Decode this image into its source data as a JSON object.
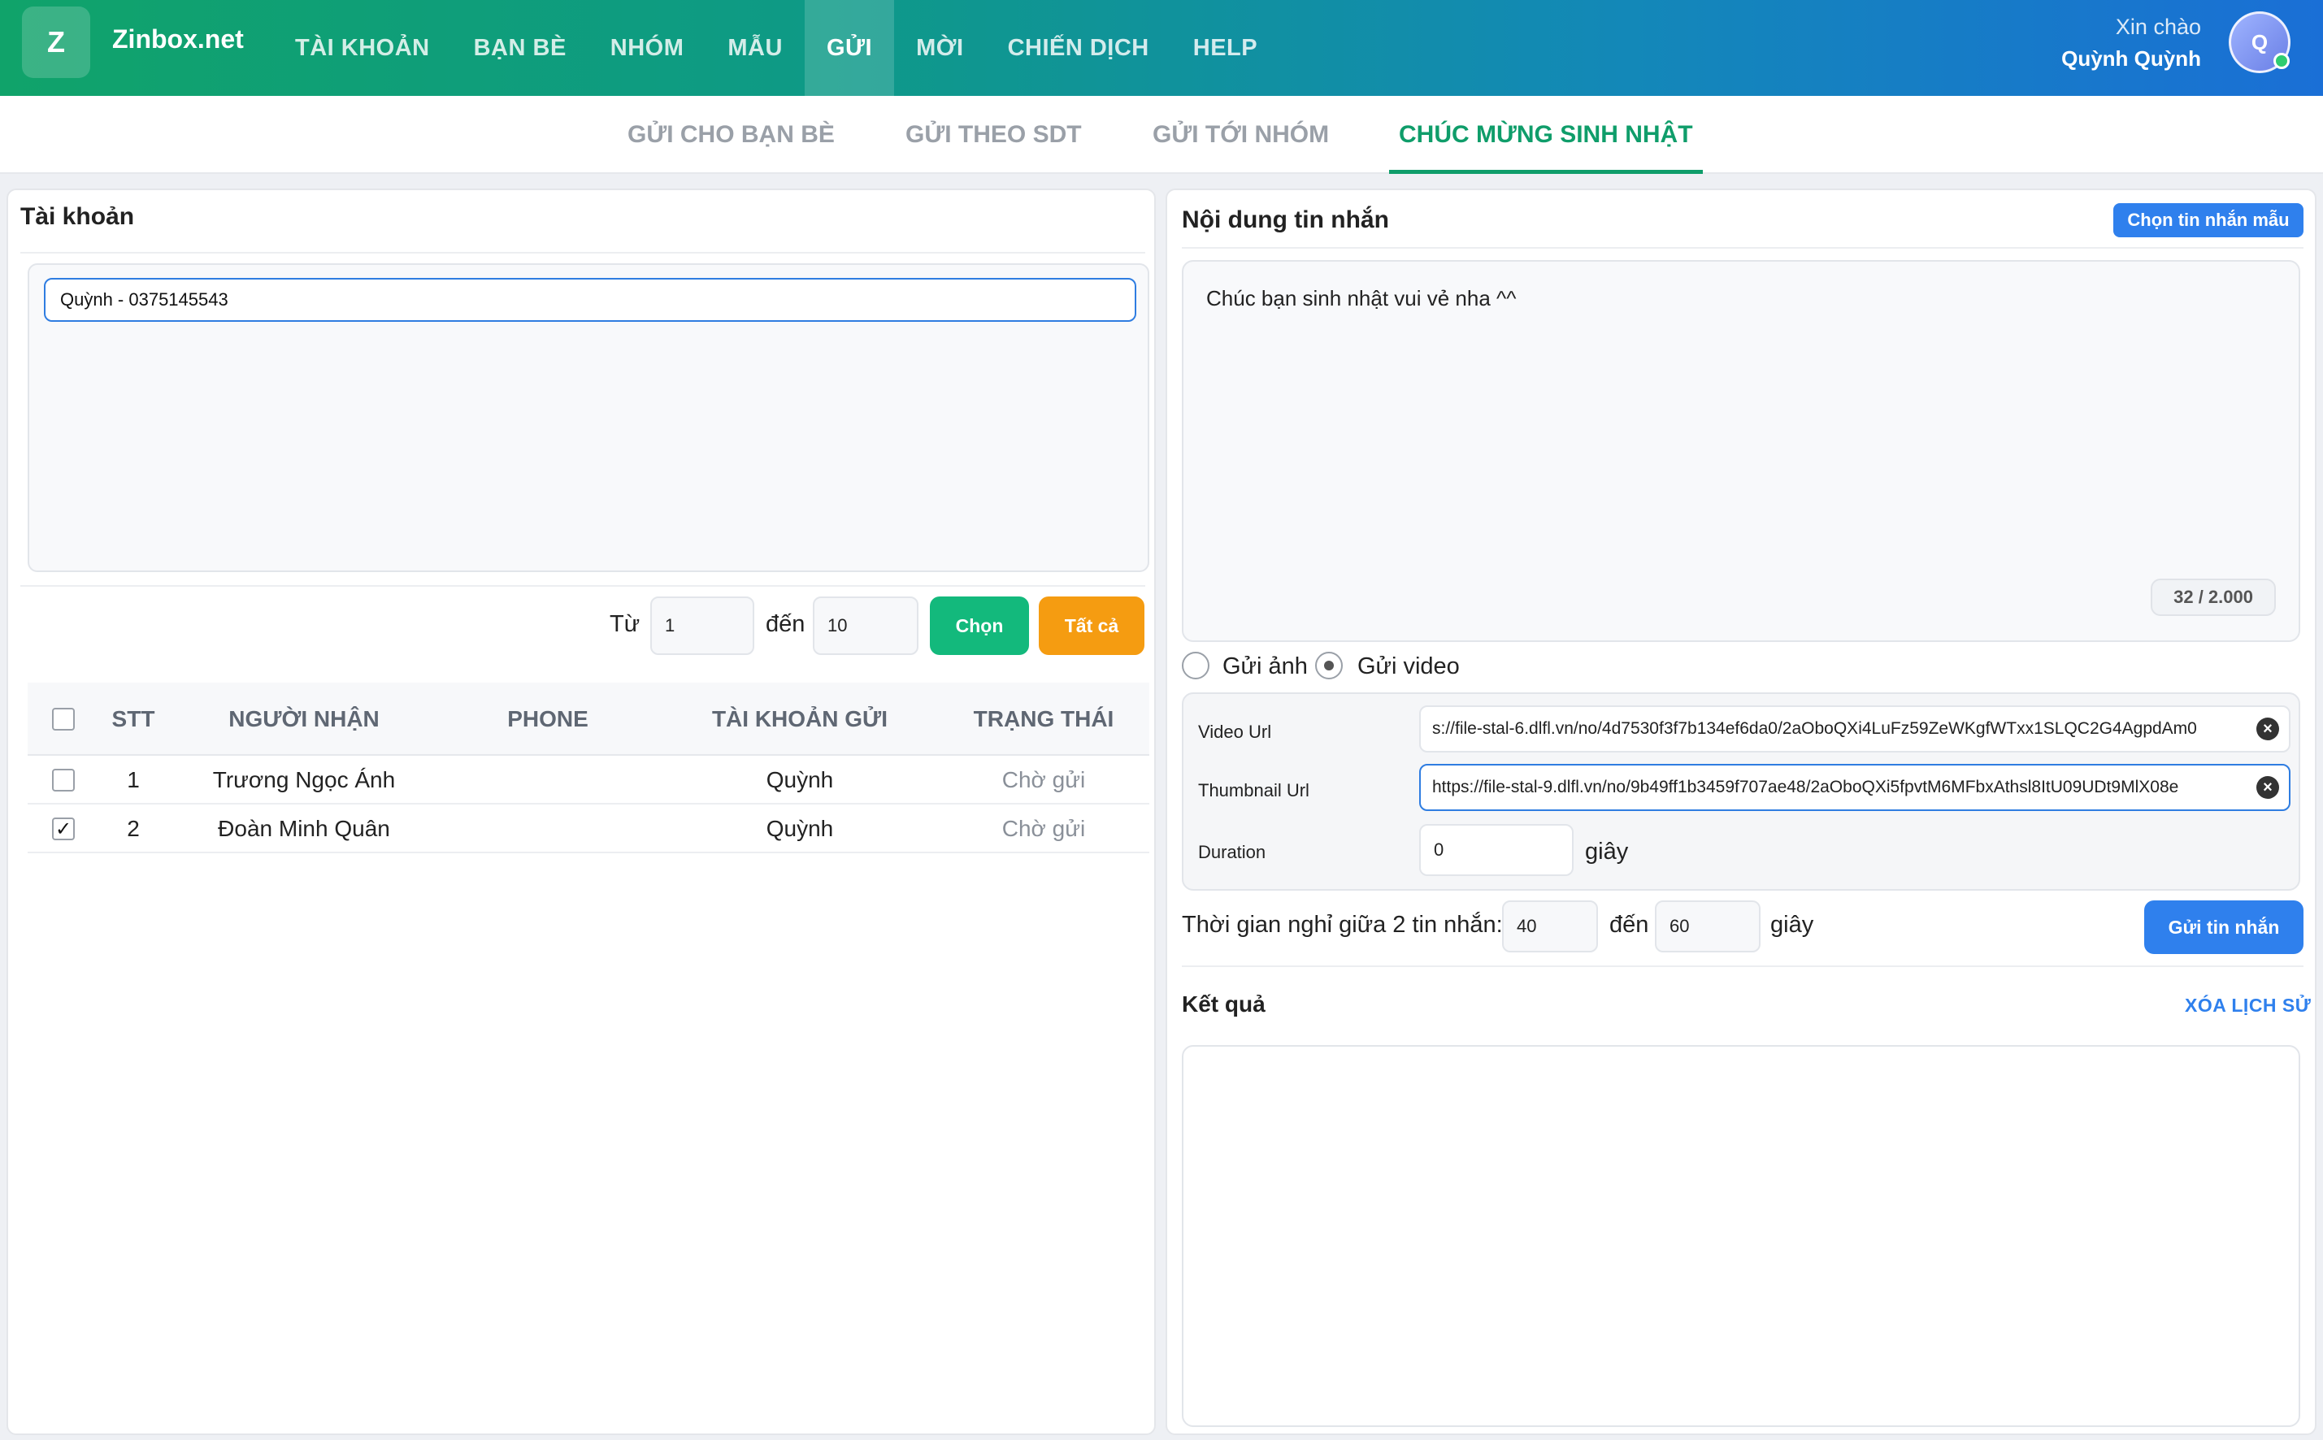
{
  "app": {
    "logo_letter": "Z",
    "brand": "Zinbox.net"
  },
  "nav": {
    "items": [
      "TÀI KHOẢN",
      "BẠN BÈ",
      "NHÓM",
      "MẪU",
      "GỬI",
      "MỜI",
      "CHIẾN DỊCH",
      "HELP"
    ],
    "active": "GỬI"
  },
  "user": {
    "greeting": "Xin chào",
    "name": "Quỳnh Quỳnh",
    "avatar_letter": "Q"
  },
  "subtabs": {
    "items": [
      "GỬI CHO BẠN BÈ",
      "GỬI THEO SDT",
      "GỬI TỚI NHÓM",
      "CHÚC MỪNG SINH NHẬT"
    ],
    "active": "CHÚC MỪNG SINH NHẬT"
  },
  "left": {
    "title": "Tài khoản",
    "selected_account": "Quỳnh - 0375145543",
    "range": {
      "from_label": "Từ",
      "from_value": "1",
      "to_label": "đến",
      "to_value": "10"
    },
    "choose_button": "Chọn",
    "all_button": "Tất cả",
    "table": {
      "headers": [
        "STT",
        "NGƯỜI NHẬN",
        "PHONE",
        "TÀI KHOẢN GỬI",
        "TRẠNG THÁI"
      ],
      "rows": [
        {
          "stt": "1",
          "recipient": "Trương Ngọc Ánh",
          "phone": "",
          "sender": "Quỳnh",
          "status": "Chờ gửi",
          "checked": false
        },
        {
          "stt": "2",
          "recipient": "Đoàn Minh Quân",
          "phone": "",
          "sender": "Quỳnh",
          "status": "Chờ gửi",
          "checked": true
        }
      ]
    }
  },
  "right": {
    "title": "Nội dung tin nhắn",
    "template_button": "Chọn tin nhắn mẫu",
    "message": "Chúc bạn sinh nhật vui vẻ nha ^^",
    "counter": "32 / 2.000",
    "media": {
      "image_label": "Gửi ảnh",
      "video_label": "Gửi video",
      "selected": "video"
    },
    "video": {
      "video_url_label": "Video Url",
      "video_url": "s://file-stal-6.dlfl.vn/no/4d7530f3f7b134ef6da0/2aOboQXi4LuFz59ZeWKgfWTxx1SLQC2G4AgpdAm0",
      "thumb_url_label": "Thumbnail Url",
      "thumb_url": "https://file-stal-9.dlfl.vn/no/9b49ff1b3459f707ae48/2aOboQXi5fpvtM6MFbxAthsl8ItU09UDt9MlX08e",
      "duration_label": "Duration",
      "duration_value": "0",
      "duration_unit": "giây"
    },
    "delay": {
      "label": "Thời gian nghỉ giữa 2 tin nhắn:",
      "from": "40",
      "to_label": "đến",
      "to": "60",
      "unit": "giây"
    },
    "send_button": "Gửi tin nhắn",
    "result_title": "Kết quả",
    "clear_history": "XÓA LỊCH SỬ"
  }
}
